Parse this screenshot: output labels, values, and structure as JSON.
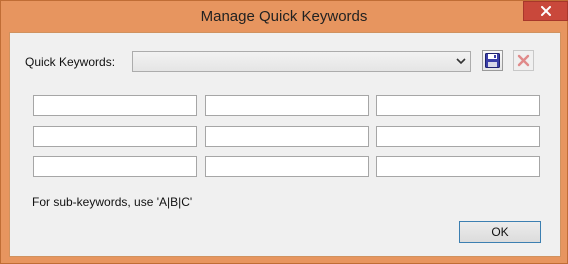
{
  "window": {
    "title": "Manage Quick Keywords"
  },
  "form": {
    "quick_keywords_label": "Quick Keywords:",
    "quick_keywords_value": "",
    "save_icon": "save-icon",
    "delete_icon": "delete-icon"
  },
  "keyword_fields": [
    "",
    "",
    "",
    "",
    "",
    "",
    "",
    "",
    ""
  ],
  "hint": "For sub-keywords, use 'A|B|C'",
  "buttons": {
    "ok_label": "OK"
  },
  "colors": {
    "frame": "#e7955f",
    "close": "#c9483b",
    "client_bg": "#f0f0f0",
    "ok_border": "#3c7fb1"
  }
}
